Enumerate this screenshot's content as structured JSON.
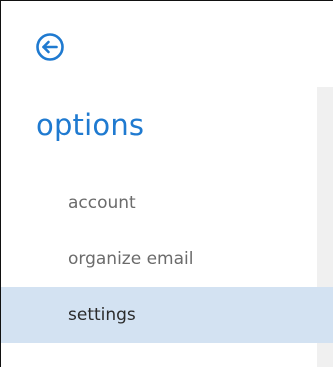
{
  "header": {
    "back_icon": "back-arrow-circle-icon",
    "title": "options"
  },
  "nav": {
    "items": [
      {
        "label": "account",
        "selected": false
      },
      {
        "label": "organize email",
        "selected": false
      },
      {
        "label": "settings",
        "selected": true
      }
    ]
  },
  "colors": {
    "accent": "#1f7ad0",
    "selected_background": "#d3e2f2",
    "item_text": "#6b6b6b",
    "selected_text": "#2b2b2b"
  }
}
